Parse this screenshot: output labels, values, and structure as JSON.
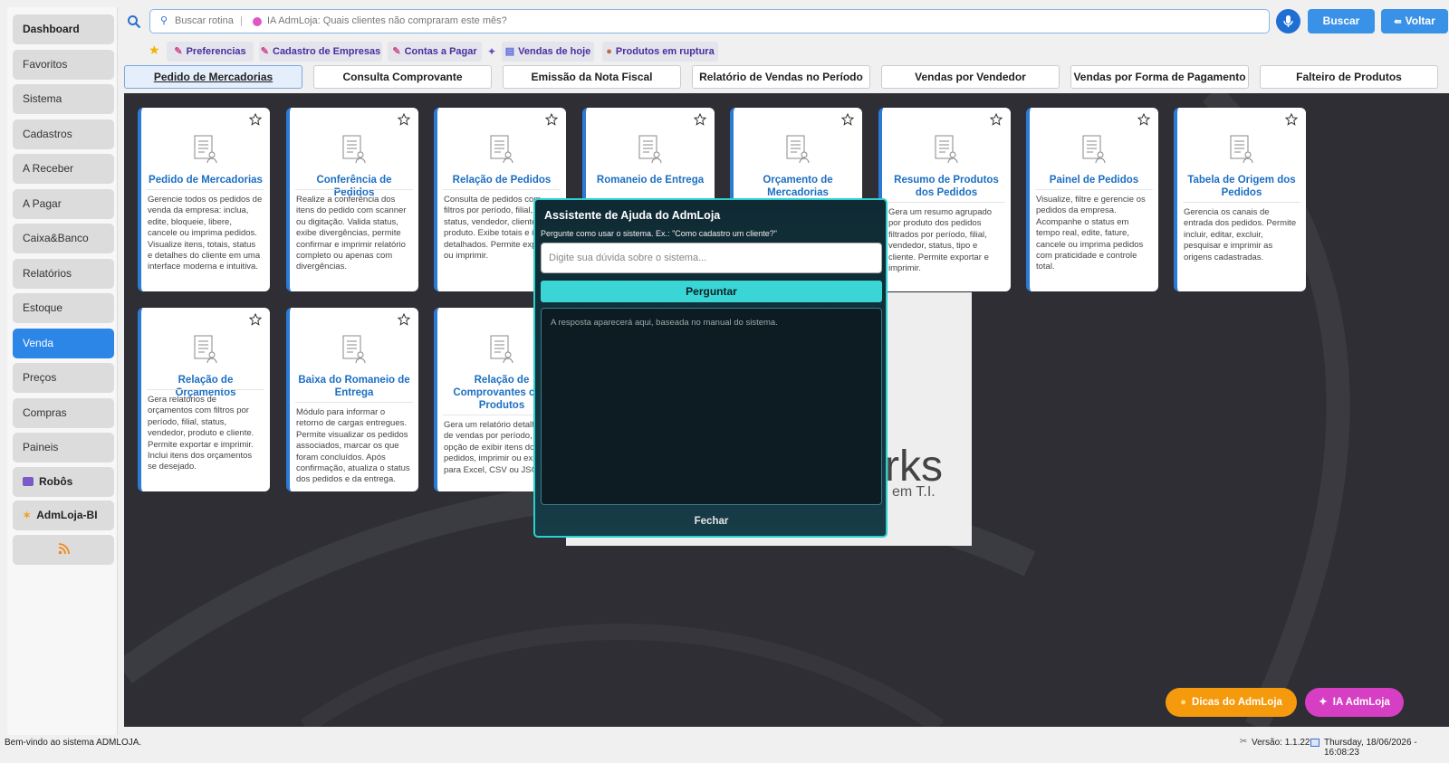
{
  "sidebar": {
    "items": [
      {
        "label": "Dashboard",
        "bold": true
      },
      {
        "label": "Favoritos"
      },
      {
        "label": "Sistema"
      },
      {
        "label": "Cadastros"
      },
      {
        "label": "A Receber"
      },
      {
        "label": "A Pagar"
      },
      {
        "label": "Caixa&Banco"
      },
      {
        "label": "Relatórios"
      },
      {
        "label": "Estoque"
      },
      {
        "label": "Venda",
        "active": true
      },
      {
        "label": "Preços"
      },
      {
        "label": "Compras"
      },
      {
        "label": "Paineis"
      },
      {
        "label": "Robôs",
        "bold": true,
        "icon": "robot-icon"
      },
      {
        "label": "AdmLoja-BI",
        "bold": true,
        "icon": "spark-icon"
      },
      {
        "label": "",
        "icon": "rss-icon"
      }
    ]
  },
  "topbar": {
    "search_placeholder": "Buscar rotina",
    "ai_placeholder": "IA AdmLoja: Quais clientes não compraram este mês?",
    "search_button": "Buscar",
    "back_button": "Voltar"
  },
  "favorites": [
    "Preferencias",
    "Cadastro de Empresas",
    "Contas a Pagar",
    "Vendas de hoje",
    "Produtos em ruptura"
  ],
  "tabs": [
    "Pedido de Mercadorias",
    "Consulta Comprovante",
    "Emissão da Nota Fiscal",
    "Relatório de Vendas no Período",
    "Vendas por Vendedor",
    "Vendas por Forma de Pagamento",
    "Falteiro de Produtos"
  ],
  "cards": [
    {
      "title": "Pedido de Mercadorias",
      "desc": "Gerencie todos os pedidos de venda da empresa: inclua, edite, bloqueie, libere, cancele ou imprima pedidos. Visualize itens, totais, status e detalhes do cliente em uma interface moderna e intuitiva."
    },
    {
      "title": "Conferência de Pedidos",
      "desc": "Realize a conferência dos itens do pedido com scanner ou digitação. Valida status, exibe divergências, permite confirmar e imprimir relatório completo ou apenas com divergências."
    },
    {
      "title": "Relação de Pedidos",
      "desc": "Consulta de pedidos com filtros por período, filial, status, vendedor, cliente e produto. Exibe totais e itens detalhados. Permite exportar ou imprimir."
    },
    {
      "title": "Romaneio de Entrega",
      "desc": ""
    },
    {
      "title": "Orçamento de Mercadorias",
      "desc": ""
    },
    {
      "title": "Resumo de Produtos dos Pedidos",
      "desc": "Gera um resumo agrupado por produto dos pedidos filtrados por período, filial, vendedor, status, tipo e cliente. Permite exportar e imprimir."
    },
    {
      "title": "Painel de Pedidos",
      "desc": "Visualize, filtre e gerencie os pedidos da empresa. Acompanhe o status em tempo real, edite, fature, cancele ou imprima pedidos com praticidade e controle total."
    },
    {
      "title": "Tabela de Origem dos Pedidos",
      "desc": "Gerencia os canais de entrada dos pedidos. Permite incluir, editar, excluir, pesquisar e imprimir as origens cadastradas."
    },
    {
      "title": "Relação de Orçamentos",
      "desc": "Gera relatórios de orçamentos com filtros por período, filial, status, vendedor, produto e cliente. Permite exportar e imprimir. Inclui itens dos orçamentos se desejado."
    },
    {
      "title": "Baixa do Romaneio de Entrega",
      "desc": "Módulo para informar o retorno de cargas entregues. Permite visualizar os pedidos associados, marcar os que foram concluídos. Após confirmação, atualiza o status dos pedidos e da entrega."
    },
    {
      "title": "Relação de Comprovantes com Produtos",
      "desc": "Gera um relatório detalhado de vendas por período, com opção de exibir itens dos pedidos, imprimir ou exportar para Excel, CSV ou JSON."
    }
  ],
  "background": {
    "brand_fragment": "rks",
    "brand_sub": "em T.I."
  },
  "modal": {
    "title": "Assistente de Ajuda do AdmLoja",
    "hint": "Pergunte como usar o sistema. Ex.: \"Como cadastro um cliente?\"",
    "input_placeholder": "Digite sua dúvida sobre o sistema...",
    "ask_button": "Perguntar",
    "answer_placeholder": "A resposta aparecerá aqui, baseada no manual do sistema.",
    "close_button": "Fechar"
  },
  "floating": {
    "tips": "Dicas do AdmLoja",
    "ai": "IA AdmLoja"
  },
  "status": {
    "welcome": "Bem-vindo ao sistema ADMLOJA.",
    "version": "Versão: 1.1.22",
    "datetime": "Thursday, 18/06/2026 - 16:08:23"
  },
  "colors": {
    "accent": "#2b86e8",
    "modal_border": "#2bd0cf",
    "card_title": "#1c6fc2",
    "tips_pill": "#f59a0c",
    "ai_pill": "#d63fc4"
  }
}
